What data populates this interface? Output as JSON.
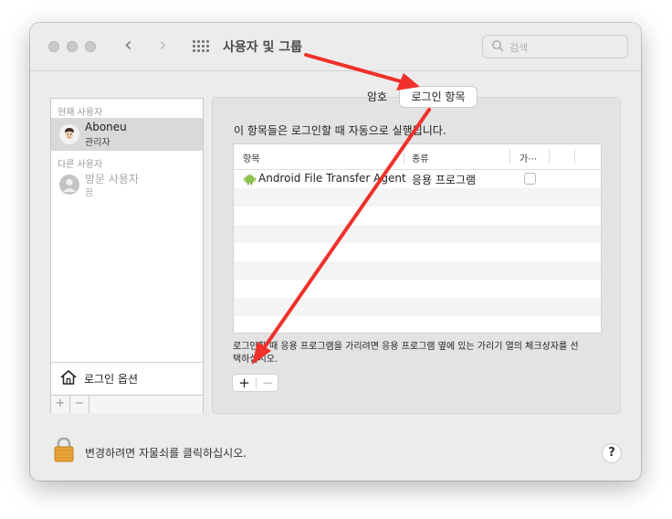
{
  "window": {
    "title": "사용자 및 그룹",
    "search_placeholder": "검색"
  },
  "sidebar": {
    "current_users_header": "현재 사용자",
    "other_users_header": "다른 사용자",
    "current_user": {
      "name": "Aboneu",
      "role": "관리자"
    },
    "guest_user": {
      "name": "방문 사용자",
      "status": "끔"
    },
    "login_options_label": "로그인 옵션",
    "add_label": "+",
    "remove_label": "−"
  },
  "tabs": [
    {
      "label": "암호",
      "selected": false
    },
    {
      "label": "로그인 항목",
      "selected": true
    }
  ],
  "login_items": {
    "description": "이 항목들은 로그인할 때 자동으로 실행됩니다.",
    "columns": [
      "항목",
      "종류",
      "가⋯"
    ],
    "rows": [
      {
        "name": "Android File Transfer Agent",
        "kind": "응용 프로그램",
        "hide": false
      }
    ],
    "hint": "로그인할 때 응용 프로그램을 가리려면 응용 프로그램 옆에 있는 가리기 열의 체크상자를 선택하십시오.",
    "add_label": "+",
    "remove_label": "−"
  },
  "footer": {
    "lock_text": "변경하려면 자물쇠를 클릭하십시오.",
    "help_label": "?"
  },
  "colors": {
    "annotation_arrow": "#f0302a",
    "window_bg": "#ececec",
    "selected_row": "#d9d9d9"
  }
}
